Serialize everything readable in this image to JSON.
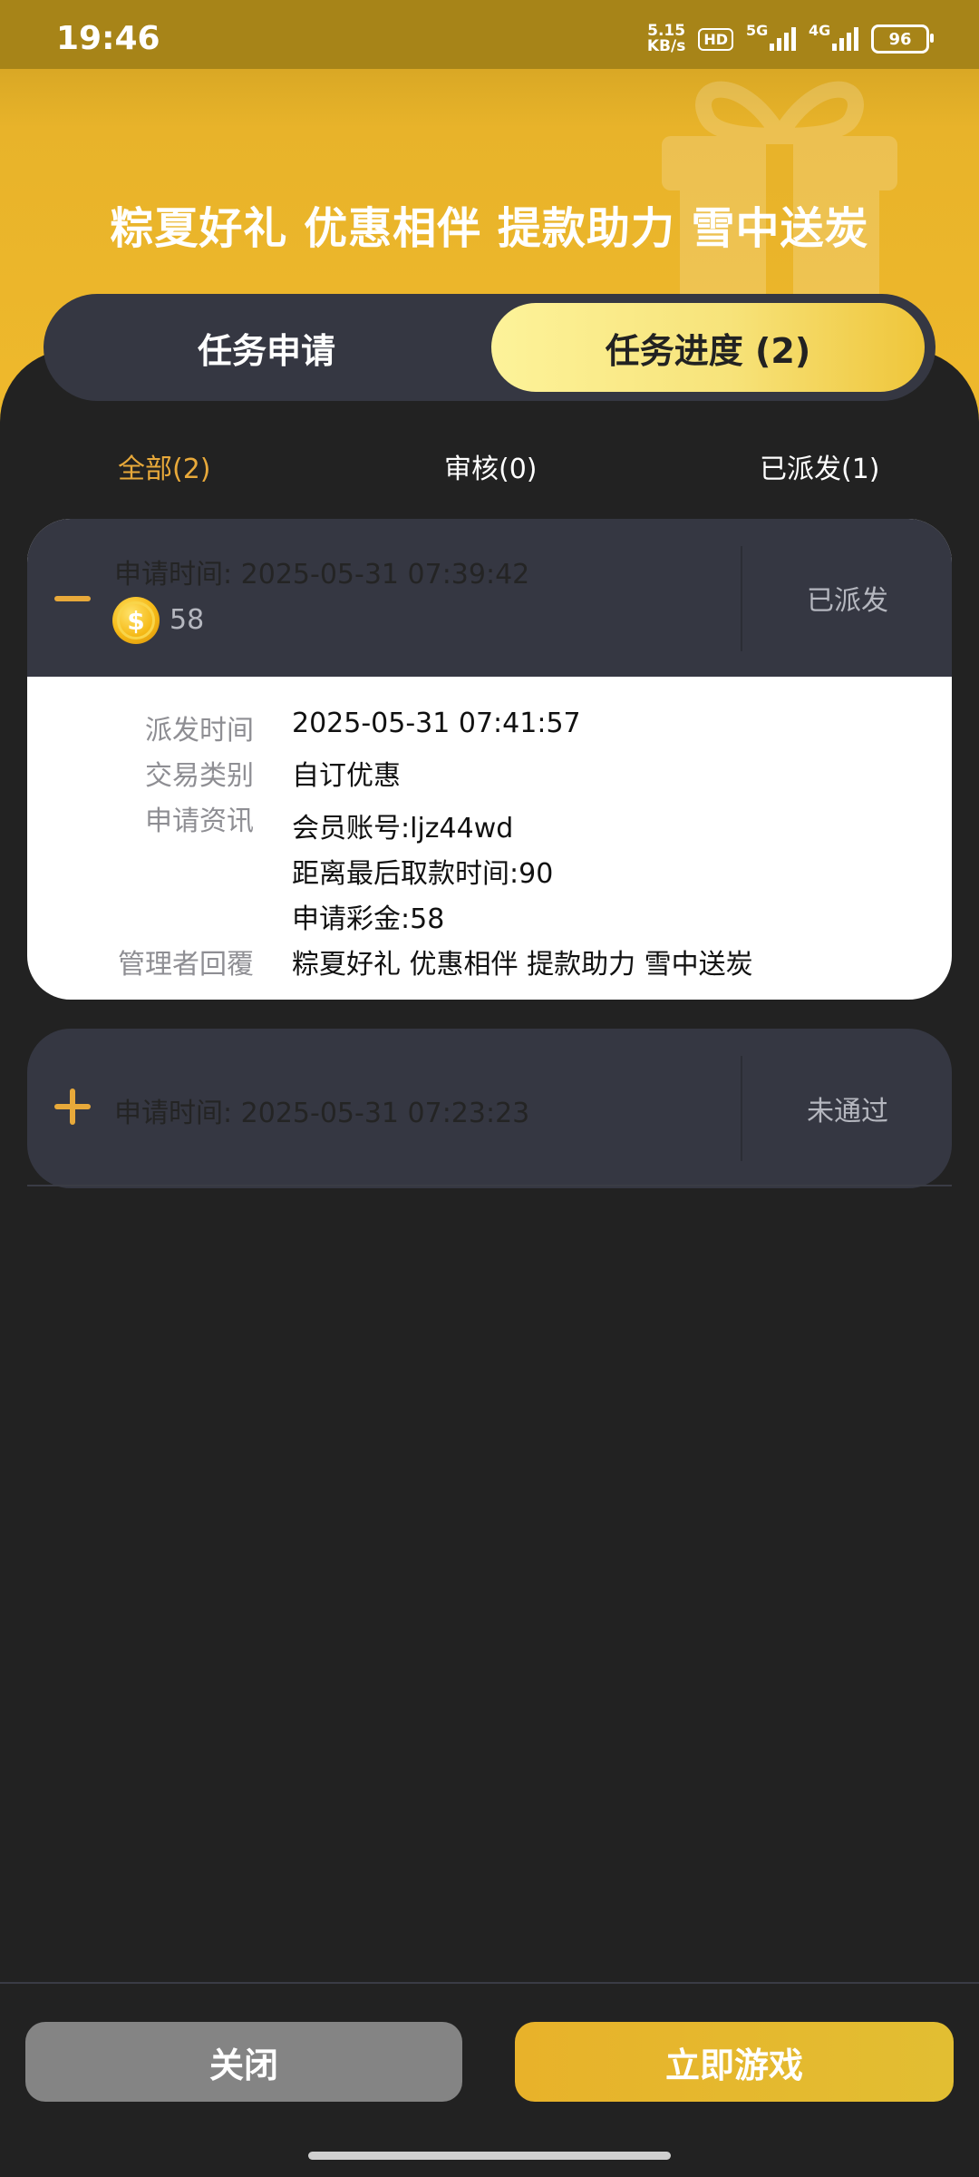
{
  "status_bar": {
    "time": "19:46",
    "net_speed_value": "5.15",
    "net_speed_unit": "KB/s",
    "hd_label": "HD",
    "signal_1": "5G",
    "signal_2": "4G",
    "battery": "96"
  },
  "header": {
    "headline": "粽夏好礼 优惠相伴 提款助力 雪中送炭"
  },
  "tabs": [
    {
      "label": "任务申请",
      "active": false
    },
    {
      "label": "任务进度 (2)",
      "active": true
    }
  ],
  "filters": [
    {
      "label": "全部(2)",
      "active": true
    },
    {
      "label": "审核(0)",
      "active": false
    },
    {
      "label": "已派发(1)",
      "active": false
    }
  ],
  "records": [
    {
      "expanded": true,
      "apply_time": "申请时间: 2025-05-31 07:39:42",
      "amount": "58",
      "status": "已派发",
      "details": {
        "dispatch_time_label": "派发时间",
        "dispatch_time": "2025-05-31 07:41:57",
        "trade_type_label": "交易类别",
        "trade_type": "自订优惠",
        "apply_info_label": "申请资讯",
        "apply_info_lines": [
          "会员账号:ljz44wd",
          "距离最后取款时间:90",
          "申请彩金:58"
        ],
        "admin_reply_label": "管理者回覆",
        "admin_reply": "粽夏好礼 优惠相伴 提款助力 雪中送炭"
      }
    },
    {
      "expanded": false,
      "apply_time": "申请时间: 2025-05-31 07:23:23",
      "status": "未通过"
    }
  ],
  "footer": {
    "close_label": "关闭",
    "play_label": "立即游戏"
  },
  "colors": {
    "accent": "#e8a93a",
    "banner": "#efb92c",
    "dark_bg": "#222222",
    "card_bg": "#353742"
  }
}
